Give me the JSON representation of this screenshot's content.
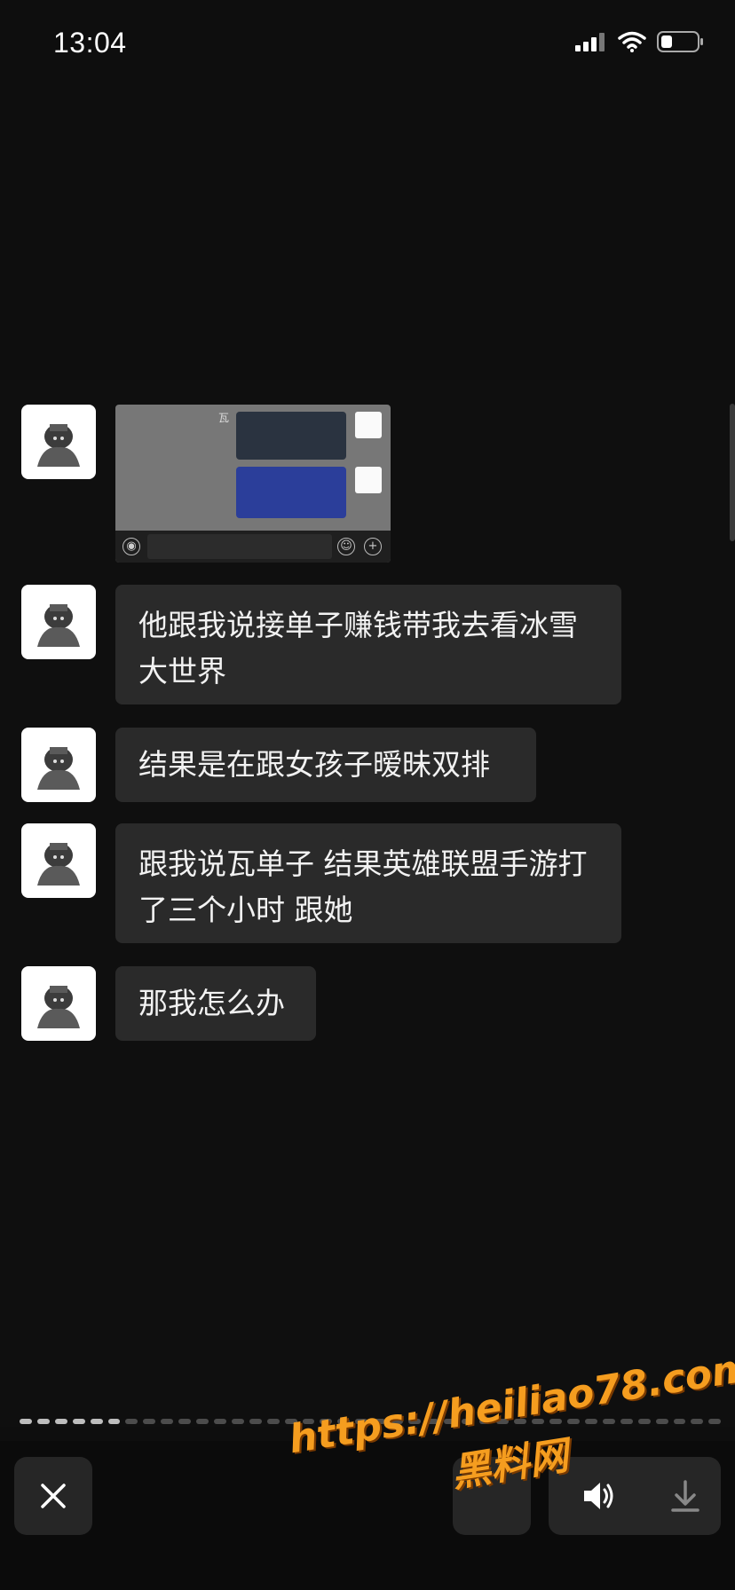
{
  "status_bar": {
    "time": "13:04",
    "icons": [
      "cellular-signal-icon",
      "wifi-icon",
      "battery-icon"
    ]
  },
  "chat": {
    "messages": [
      {
        "type": "image",
        "thumbnail_label": "瓦"
      },
      {
        "type": "text",
        "text": "他跟我说接单子赚钱带我去看冰雪大世界"
      },
      {
        "type": "text",
        "text": "结果是在跟女孩子暧昧双排"
      },
      {
        "type": "text",
        "text": "跟我说瓦单子 结果英雄联盟手游打了三个小时 跟她"
      },
      {
        "type": "text",
        "text": "那我怎么办"
      }
    ]
  },
  "progress": {
    "total_segments": 40,
    "active_segments": 6
  },
  "toolbar": {
    "close_icon": "close-icon",
    "icons": [
      "speaker-icon",
      "download-icon"
    ]
  },
  "watermark": {
    "url": "https://heiliao78.com",
    "site": "黑料网"
  },
  "colors": {
    "background": "#0e0e0e",
    "bubble": "#2a2a2a",
    "watermark": "#f59d1f"
  }
}
